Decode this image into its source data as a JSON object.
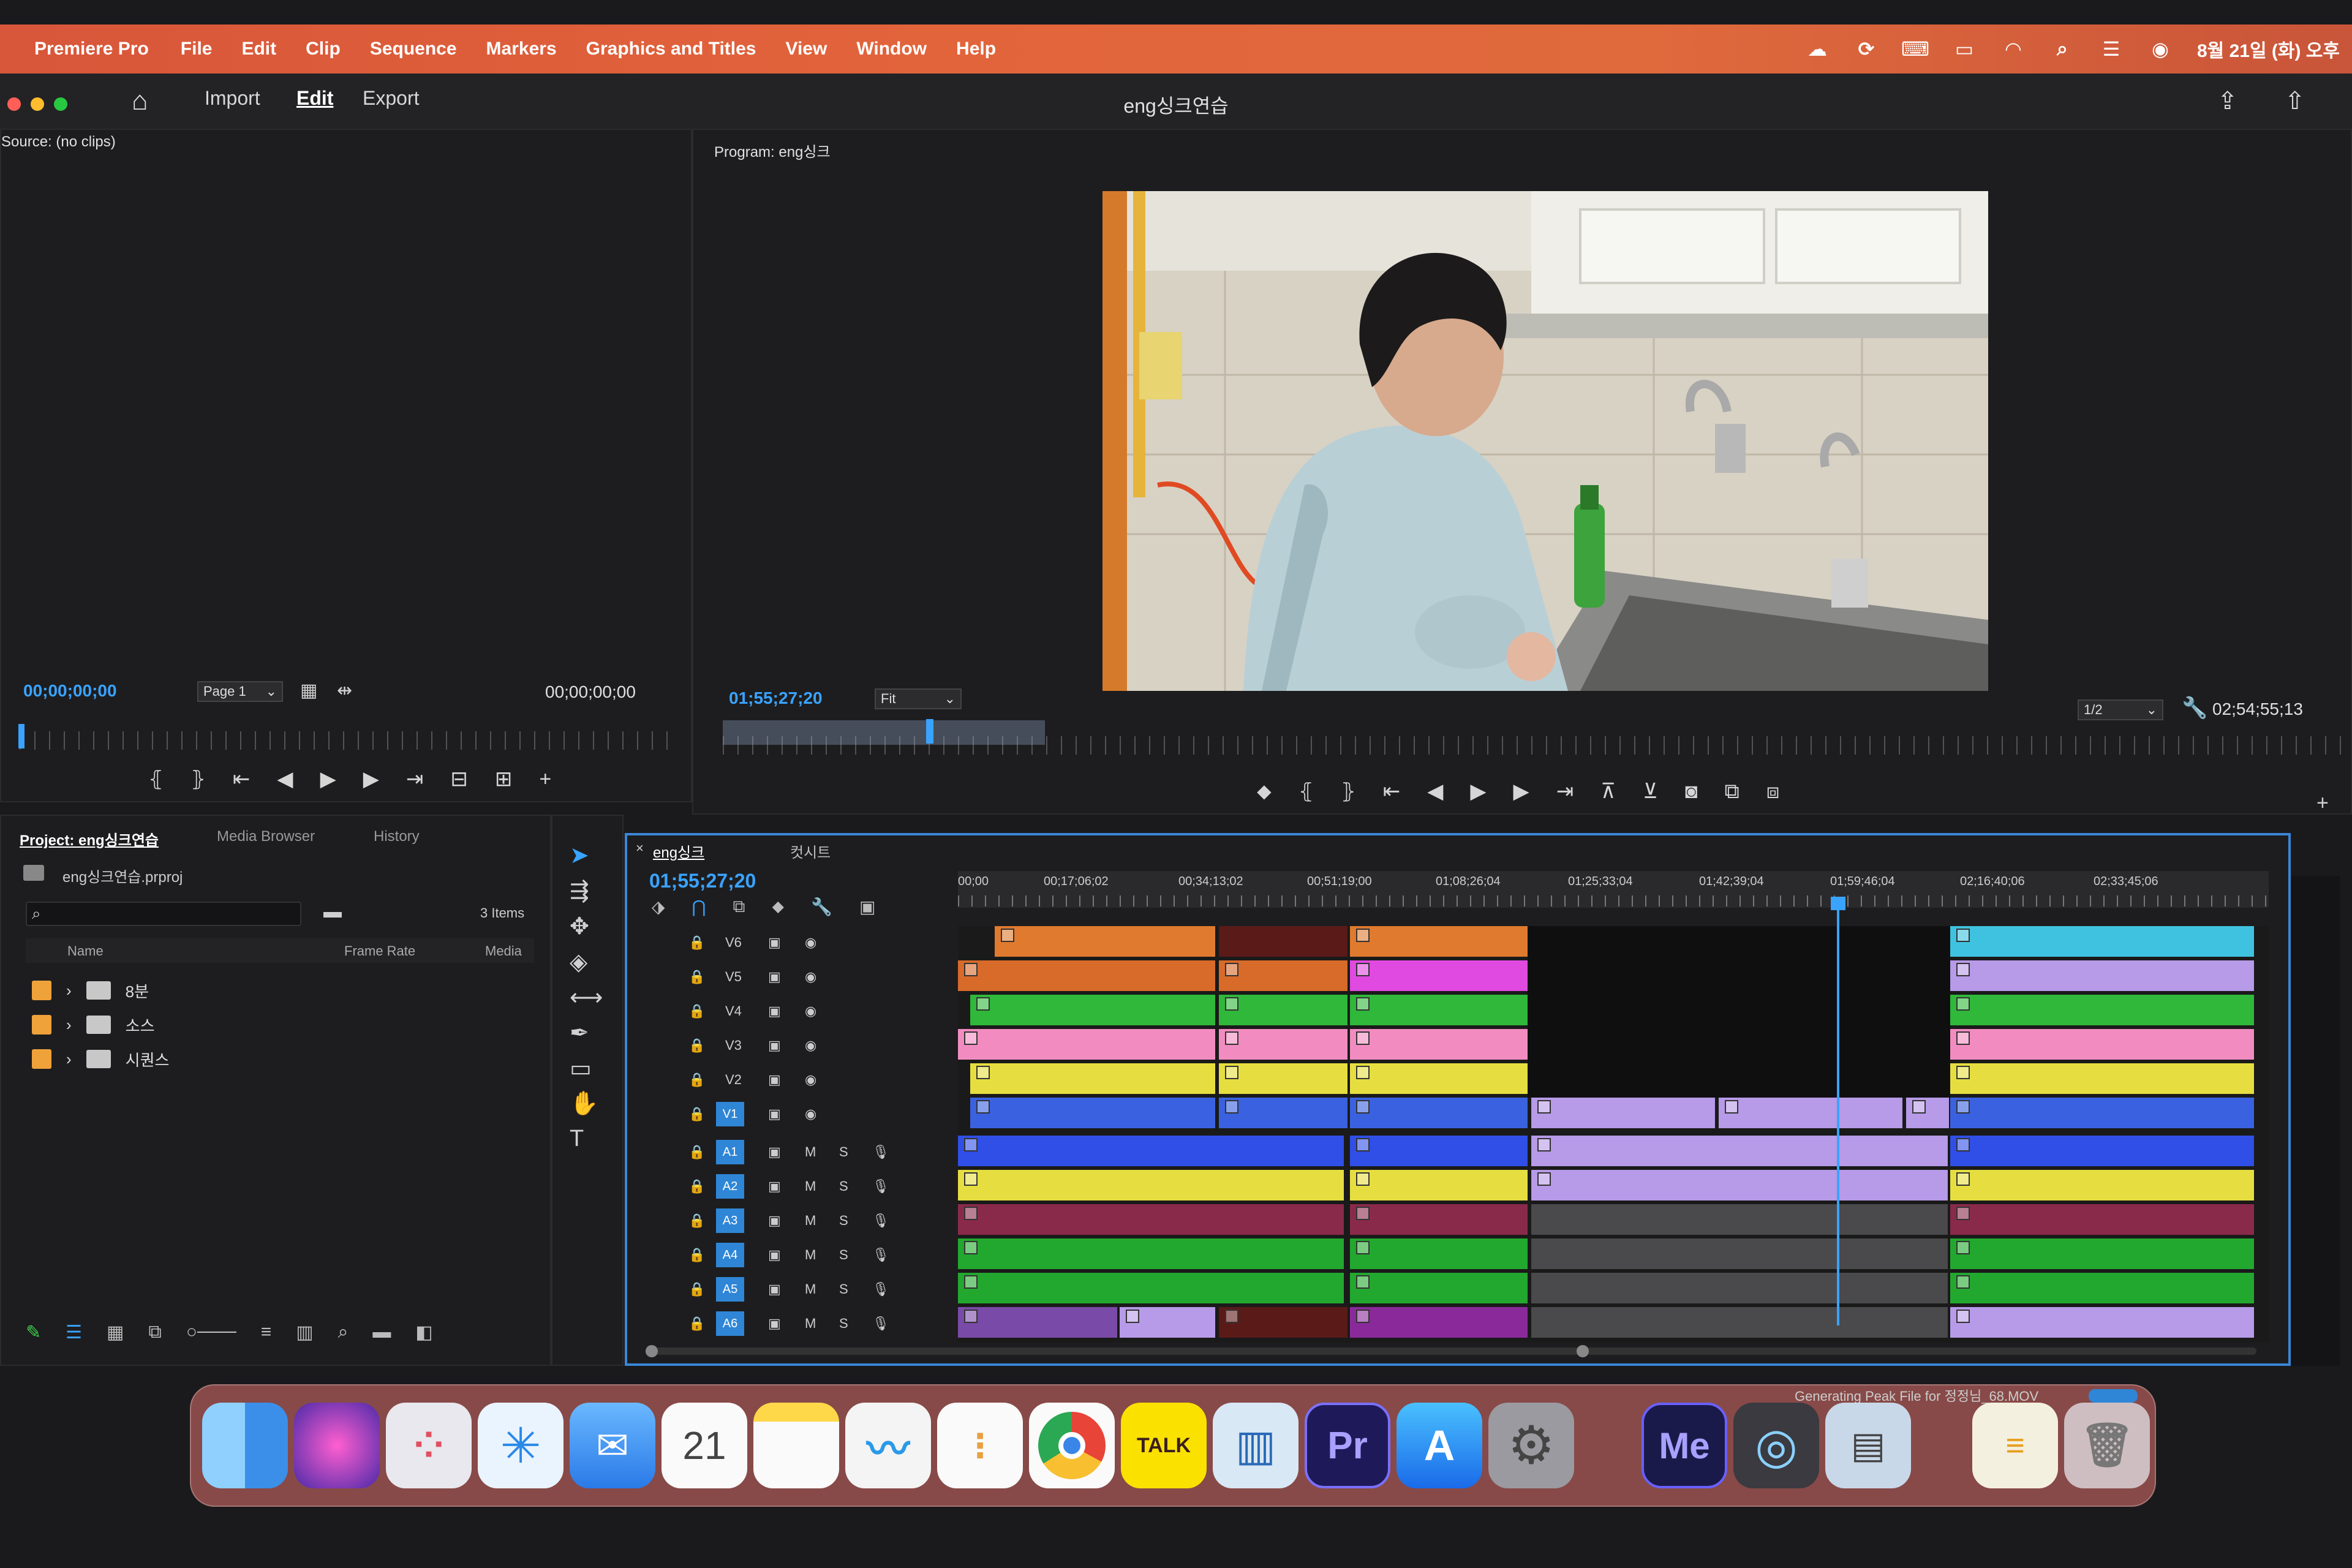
{
  "menubar": {
    "app": "Premiere Pro",
    "items": [
      "File",
      "Edit",
      "Clip",
      "Sequence",
      "Markers",
      "Graphics and Titles",
      "View",
      "Window",
      "Help"
    ],
    "datetime": "8월 21일 (화) 오후"
  },
  "header": {
    "nav": [
      "Import",
      "Edit",
      "Export"
    ],
    "active": "Edit",
    "project_title": "eng싱크연습"
  },
  "source": {
    "title": "Source: (no clips)",
    "timecode_in": "00;00;00;00",
    "page": "Page 1",
    "timecode_out": "00;00;00;00"
  },
  "program": {
    "title": "Program: eng싱크",
    "timecode": "01;55;27;20",
    "fit": "Fit",
    "resolution": "1/2",
    "duration": "02;54;55;13"
  },
  "project": {
    "tabs": [
      "Project: eng싱크연습",
      "Media Browser",
      "History"
    ],
    "file": "eng싱크연습.prproj",
    "items_count": "3 Items",
    "columns": [
      "Name",
      "Frame Rate",
      "Media"
    ],
    "folders": [
      "8분",
      "소스",
      "시퀀스"
    ]
  },
  "timeline": {
    "tabs": [
      "eng싱크",
      "컷시트"
    ],
    "timecode": "01;55;27;20",
    "ruler": [
      "00;00",
      "00;17;06;02",
      "00;34;13;02",
      "00;51;19;00",
      "01;08;26;04",
      "01;25;33;04",
      "01;42;39;04",
      "01;59;46;04",
      "02;16;40;06",
      "02;33;45;06"
    ],
    "video_tracks": [
      "V6",
      "V5",
      "V4",
      "V3",
      "V2",
      "V1"
    ],
    "audio_tracks": [
      "A1",
      "A2",
      "A3",
      "A4",
      "A5",
      "A6"
    ]
  },
  "dock": {
    "status": "Generating Peak File for 정정님_68.MOV",
    "calendar_day": "21",
    "labels": {
      "premiere": "Pr",
      "talk": "TALK",
      "media_encoder": "Me"
    }
  },
  "colors": {
    "accent": "#3aa3ff",
    "menubar": "#e2643b",
    "timeline_border": "#3a86d8"
  }
}
